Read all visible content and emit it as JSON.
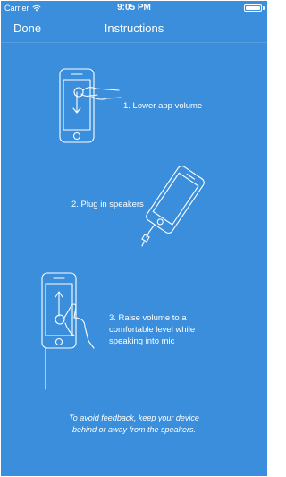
{
  "status_bar": {
    "carrier": "Carrier",
    "time": "9:05 PM",
    "battery_level": 1.0
  },
  "nav": {
    "done_label": "Done",
    "title": "Instructions"
  },
  "steps": [
    {
      "text": "1. Lower app volume",
      "icon": "phone-swipe-down-illustration"
    },
    {
      "text": "2. Plug in speakers",
      "icon": "phone-plug-in-illustration"
    },
    {
      "text_lines": [
        "3. Raise volume to a",
        "comfortable level while",
        "speaking into mic"
      ],
      "icon": "phone-swipe-up-illustration"
    }
  ],
  "footer": {
    "line1": "To avoid feedback, keep your device",
    "line2": "behind or away from the speakers."
  },
  "colors": {
    "background": "#3a8edb",
    "foreground": "#ffffff"
  }
}
